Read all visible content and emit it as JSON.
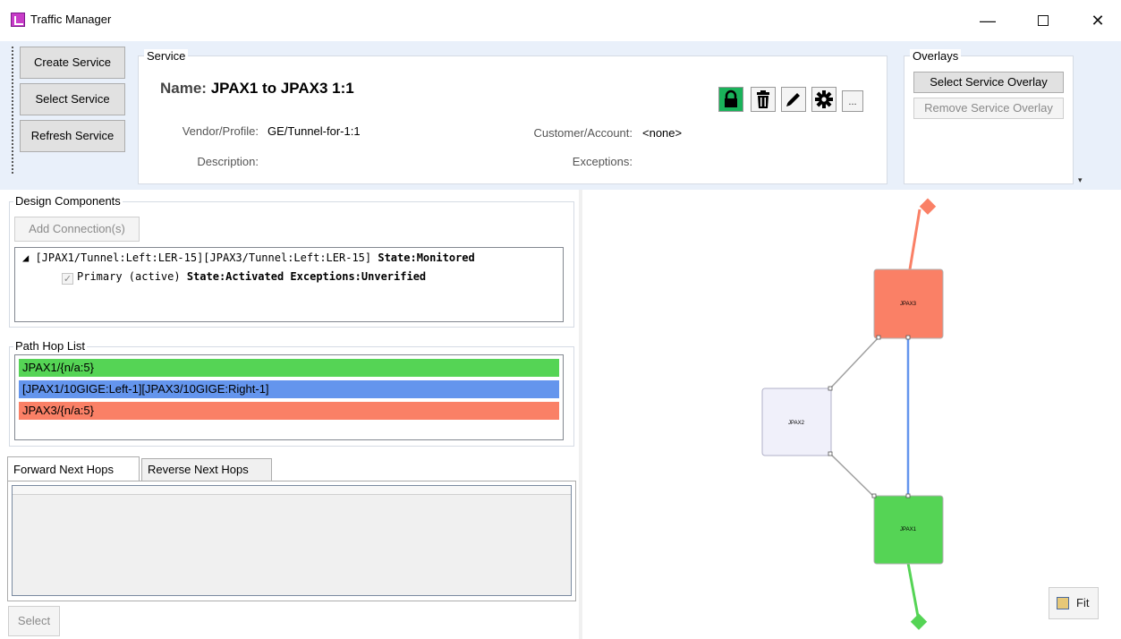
{
  "window": {
    "title": "Traffic Manager",
    "controls": [
      "—",
      "□",
      "✕"
    ]
  },
  "ribbon": {
    "buttons": [
      "Create Service",
      "Select Service",
      "Refresh Service"
    ],
    "service": {
      "group_label": "Service",
      "name_label": "Name:",
      "name_value": "JPAX1 to JPAX3 1:1",
      "vendor_label": "Vendor/Profile:",
      "vendor_value": "GE/Tunnel-for-1:1",
      "customer_label": "Customer/Account:",
      "customer_value": "<none>",
      "description_label": "Description:",
      "description_value": "",
      "exceptions_label": "Exceptions:",
      "exceptions_value": "",
      "tools": [
        "lock-icon",
        "trash-icon",
        "pencil-icon",
        "gear-icon"
      ],
      "more_label": "..."
    },
    "overlays": {
      "group_label": "Overlays",
      "select_label": "Select Service Overlay",
      "remove_label": "Remove Service Overlay"
    }
  },
  "design": {
    "label": "Design Components",
    "add_label": "Add Connection(s)",
    "tree": {
      "root_prefix": "◢ [JPAX1/Tunnel:Left:LER-15][JPAX3/Tunnel:Left:LER-15] ",
      "root_state": "State:Monitored",
      "child_check": "✓",
      "child_prefix": "Primary (active) ",
      "child_state": "State:Activated Exceptions:Unverified"
    }
  },
  "path_hops": {
    "label": "Path Hop List",
    "items": [
      {
        "text": "JPAX1/{n/a:5}",
        "color": "#55d455"
      },
      {
        "text": "[JPAX1/10GIGE:Left-1][JPAX3/10GIGE:Right-1]",
        "color": "#6495ed"
      },
      {
        "text": "JPAX3/{n/a:5}",
        "color": "#fa8066"
      }
    ]
  },
  "next_hops": {
    "tabs": [
      "Forward Next Hops",
      "Reverse Next Hops"
    ],
    "active_tab": "Forward Next Hops"
  },
  "select_label": "Select",
  "graph": {
    "nodes": [
      {
        "name": "JPAX3",
        "color": "#fa8066"
      },
      {
        "name": "JPAX2",
        "color": "#f0f0fa"
      },
      {
        "name": "JPAX1",
        "color": "#55d455"
      }
    ],
    "colors": {
      "primary_path": "#6495ed",
      "link": "#a0a0a0"
    },
    "fit_label": "Fit"
  }
}
